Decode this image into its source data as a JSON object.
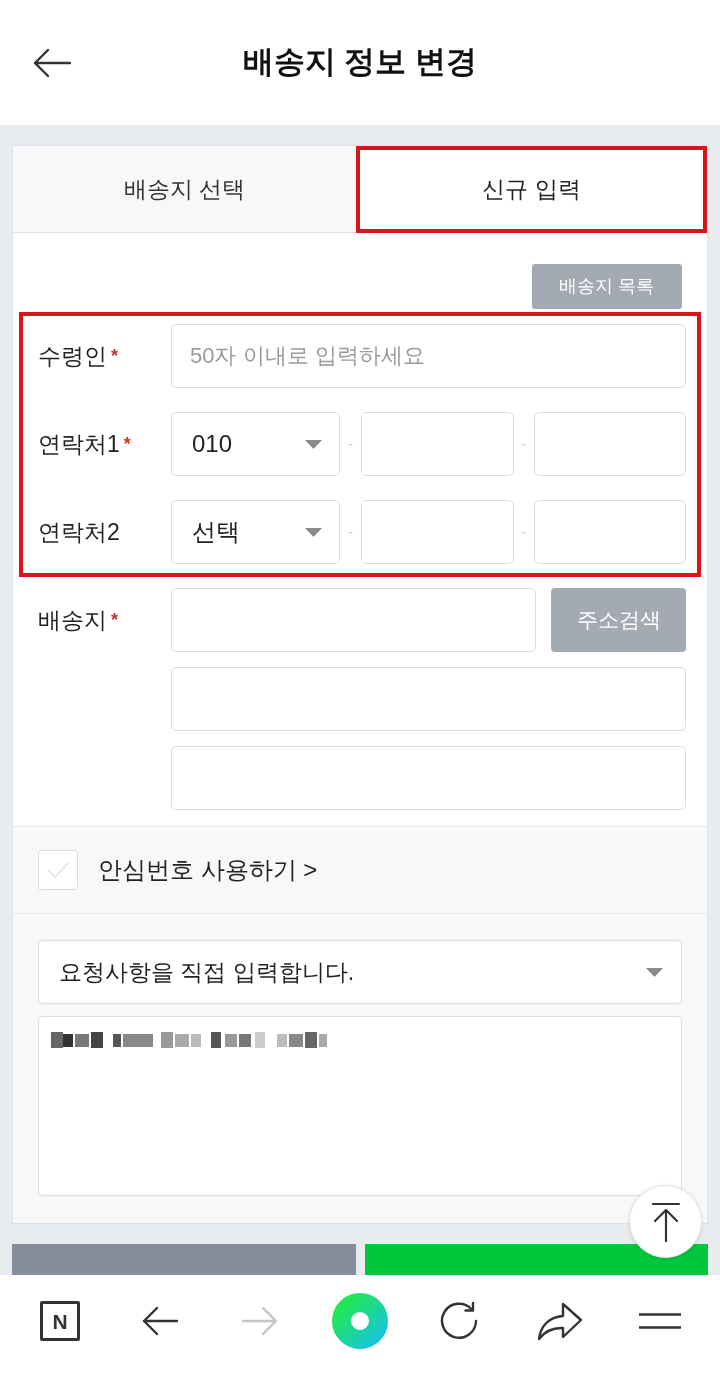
{
  "header": {
    "title": "배송지 정보 변경"
  },
  "tabs": [
    {
      "label": "배송지 선택",
      "selected": false,
      "highlighted": false
    },
    {
      "label": "신규 입력",
      "selected": true,
      "highlighted": true
    }
  ],
  "list_button": {
    "label": "배송지 목록"
  },
  "form": {
    "groups": [
      {
        "highlighted": true,
        "rows": [
          {
            "kind": "text",
            "label": "수령인",
            "required_mark": "*",
            "placeholder": "50자 이내로 입력하세요"
          },
          {
            "kind": "phone",
            "label": "연락처1",
            "required_mark": "*",
            "prefix": "010",
            "separators": [
              "-",
              "-"
            ]
          },
          {
            "kind": "phone",
            "label": "연락처2",
            "prefix": "선택",
            "separators": [
              "-",
              "-"
            ]
          }
        ]
      },
      {
        "highlighted": false,
        "rows": [
          {
            "kind": "address",
            "label": "배송지",
            "required_mark": "*",
            "button": "주소검색"
          }
        ]
      }
    ]
  },
  "safe_number": {
    "label": "안심번호 사용하기 >",
    "checked": false
  },
  "request": {
    "select": {
      "value": "요청사항을 직접 입력합니다."
    }
  },
  "footer_buttons": [
    {
      "color": "#878d9d"
    },
    {
      "color": "#00c73c"
    }
  ],
  "browser_toolbar": [
    {
      "kind": "logo",
      "text": "N",
      "disabled": false
    },
    {
      "kind": "back",
      "disabled": false
    },
    {
      "kind": "forward",
      "disabled": true
    },
    {
      "kind": "ring",
      "disabled": false
    },
    {
      "kind": "reload",
      "disabled": false
    },
    {
      "kind": "share",
      "disabled": false
    },
    {
      "kind": "menu",
      "disabled": false
    }
  ]
}
